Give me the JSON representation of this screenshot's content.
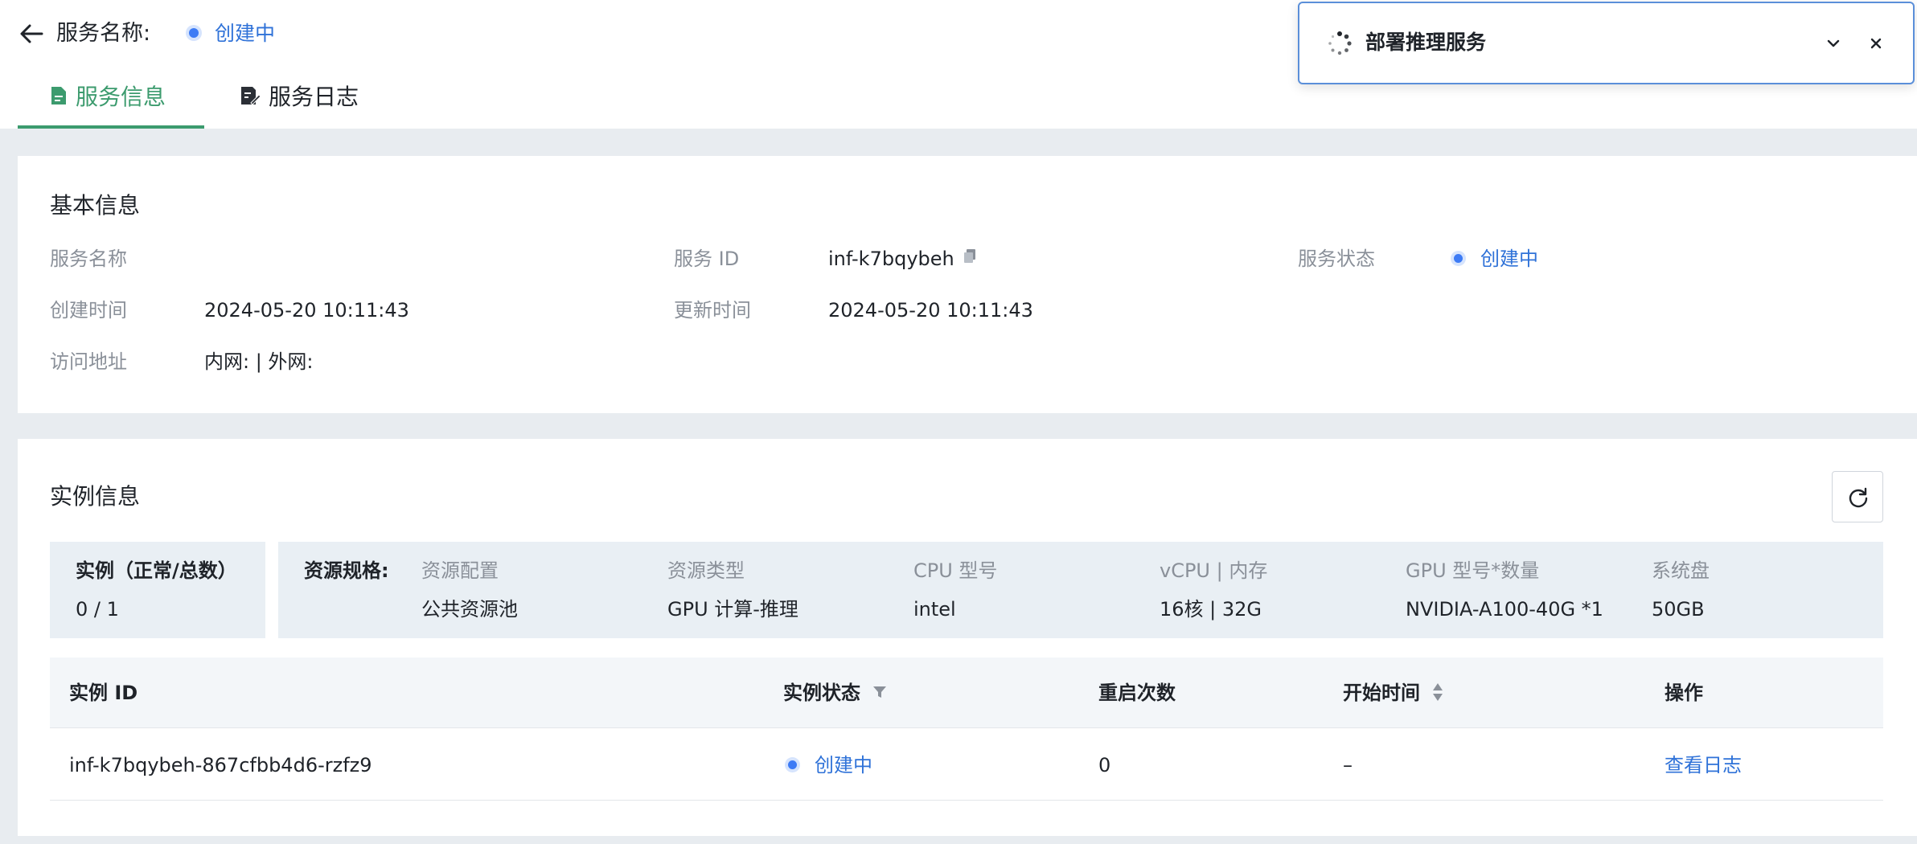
{
  "header": {
    "service_name_label": "服务名称:",
    "status_text": "创建中",
    "tabs": [
      {
        "label": "服务信息",
        "icon": "document-icon",
        "active": true
      },
      {
        "label": "服务日志",
        "icon": "edit-document-icon",
        "active": false
      }
    ]
  },
  "toast": {
    "title": "部署推理服务",
    "icon": "loading-spinner-icon"
  },
  "basic": {
    "title": "基本信息",
    "service_name_label": "服务名称",
    "service_name_value": "",
    "service_id_label": "服务 ID",
    "service_id_value": "inf-k7bqybeh",
    "service_status_label": "服务状态",
    "service_status_value": "创建中",
    "created_label": "创建时间",
    "created_value": "2024-05-20 10:11:43",
    "updated_label": "更新时间",
    "updated_value": "2024-05-20 10:11:43",
    "access_label": "访问地址",
    "access_value": "内网: | 外网:"
  },
  "instance": {
    "title": "实例信息",
    "count_label": "实例（正常/总数）",
    "count_value": "0 / 1",
    "spec_label": "资源规格:",
    "spec": [
      {
        "label": "资源配置",
        "value": "公共资源池"
      },
      {
        "label": "资源类型",
        "value": "GPU 计算-推理"
      },
      {
        "label": "CPU 型号",
        "value": "intel"
      },
      {
        "label": "vCPU | 内存",
        "value": "16核 | 32G"
      },
      {
        "label": "GPU 型号*数量",
        "value": "NVIDIA-A100-40G *1"
      },
      {
        "label": "系统盘",
        "value": "50GB"
      }
    ],
    "table": {
      "headers": [
        "实例 ID",
        "实例状态",
        "重启次数",
        "开始时间",
        "操作"
      ],
      "rows": [
        {
          "id": "inf-k7bqybeh-867cfbb4d6-rzfz9",
          "status": "创建中",
          "restarts": "0",
          "start_time": "–",
          "action": "查看日志"
        }
      ]
    }
  },
  "colors": {
    "accent_green": "#3c9b6e",
    "link_blue": "#2f72d8",
    "status_dot": "#3d7bf5"
  }
}
